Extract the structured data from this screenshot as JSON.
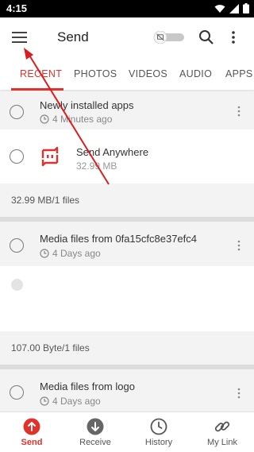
{
  "statusbar": {
    "time": "4:15"
  },
  "appbar": {
    "title": "Send"
  },
  "tabs": [
    {
      "label": "RECENT"
    },
    {
      "label": "PHOTOS"
    },
    {
      "label": "VIDEOS"
    },
    {
      "label": "AUDIO"
    },
    {
      "label": "APPS"
    }
  ],
  "groups": [
    {
      "title": "Newly installed apps",
      "time": "4 Minutes ago",
      "items": [
        {
          "name": "Send Anywhere",
          "size": "32.99 MB"
        }
      ],
      "summary": "32.99 MB/1 files"
    },
    {
      "title": "Media files from 0fa15cfc8e37efc4",
      "time": "4 Days ago",
      "summary": "107.00 Byte/1 files"
    },
    {
      "title": "Media files from logo",
      "time": "4 Days ago"
    }
  ],
  "bottomnav": [
    {
      "label": "Send",
      "icon": "send-icon"
    },
    {
      "label": "Receive",
      "icon": "receive-icon"
    },
    {
      "label": "History",
      "icon": "history-icon"
    },
    {
      "label": "My Link",
      "icon": "link-icon"
    }
  ],
  "colors": {
    "accent": "#e0312b",
    "arrow": "#d81e1e"
  }
}
